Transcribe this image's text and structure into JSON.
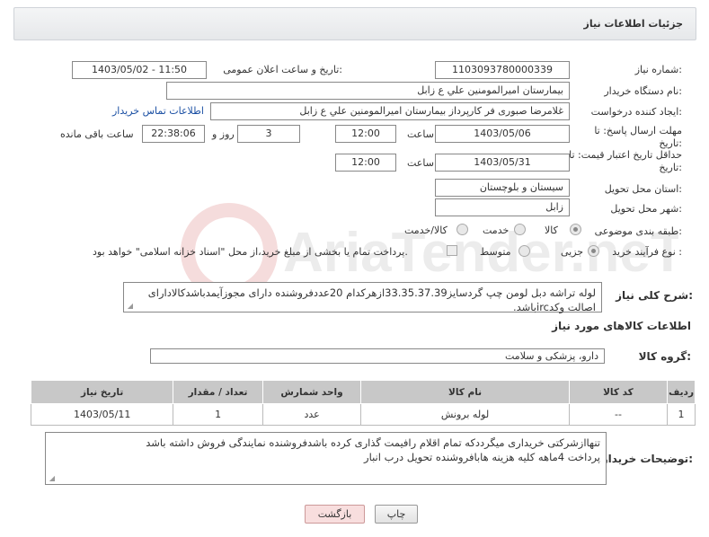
{
  "panel": {
    "title": "جزئیات اطلاعات نیاز"
  },
  "fields": {
    "need_number_label": "شماره نیاز:",
    "need_number": "1103093780000339",
    "announce_label": "تاریخ و ساعت اعلان عمومی:",
    "announce_value": "1403/05/02 - 11:50",
    "buyer_org_label": "نام دستگاه خریدار:",
    "buyer_org": "بیمارستان امیرالمومنین علي  ع  زابل",
    "creator_label": "ایجاد کننده درخواست:",
    "creator": "غلامرضا صبوری فر کارپرداز بیمارستان امیرالمومنین علي  ع  زابل",
    "contact_link": "اطلاعات تماس خریدار",
    "deadline_label_1": "مهلت ارسال پاسخ: تا",
    "deadline_label_2": "تاریخ:",
    "deadline_date": "1403/05/06",
    "time_label": "ساعت",
    "deadline_time": "12:00",
    "days_value": "3",
    "days_label": "روز و",
    "remaining_time": "22:38:06",
    "remaining_label": "ساعت باقی مانده",
    "validity_label_1": "حداقل تاریخ اعتبار قیمت: تا",
    "validity_label_2": "تاریخ:",
    "validity_date": "1403/05/31",
    "validity_time_label": "ساعت",
    "validity_time": "12:00",
    "province_label": "استان محل تحویل:",
    "province": "سیستان و بلوچستان",
    "city_label": "شهر محل تحویل:",
    "city": "زابل",
    "category_label": "طبقه بندی موضوعی:",
    "category_options": [
      "کالا",
      "خدمت",
      "کالا/خدمت"
    ],
    "process_label": "نوع فرآیند خرید :",
    "process_options": [
      "جزیی",
      "متوسط"
    ],
    "payment_note": "پرداخت تمام یا بخشی از مبلغ خرید،از محل \"اسناد خزانه اسلامی\" خواهد بود."
  },
  "description": {
    "label": "شرح کلی نیاز:",
    "text": "لوله تراشه دبل لومن چپ گردسایز33.35.37.39ازهرکدام 20عددفروشنده دارای مجوزآیمدباشدکالادارای اصالت وکدircباشد."
  },
  "goods_section": {
    "title": "اطلاعات کالاهای مورد نیاز",
    "group_label": "گروه کالا:",
    "group_value": "دارو، پزشکی و سلامت"
  },
  "table": {
    "headers": [
      "ردیف",
      "کد کالا",
      "نام کالا",
      "واحد شمارش",
      "تعداد / مقدار",
      "تاریخ نیاز"
    ],
    "rows": [
      [
        "1",
        "--",
        "لوله برونش",
        "عدد",
        "1",
        "1403/05/11"
      ]
    ]
  },
  "buyer_notes": {
    "label": "توضیحات خریدار:",
    "line1": "تنهاازشرکتی خریداری میگرددکه تمام اقلام رافیمت گذاری کرده باشدفروشنده نمایندگی فروش داشته باشد",
    "line2": "پرداخت 4ماهه کلیه هزینه هابافروشنده تحویل درب انبار"
  },
  "buttons": {
    "print": "چاپ",
    "back": "بازگشت"
  },
  "watermark_text": "AriaTender.neT"
}
